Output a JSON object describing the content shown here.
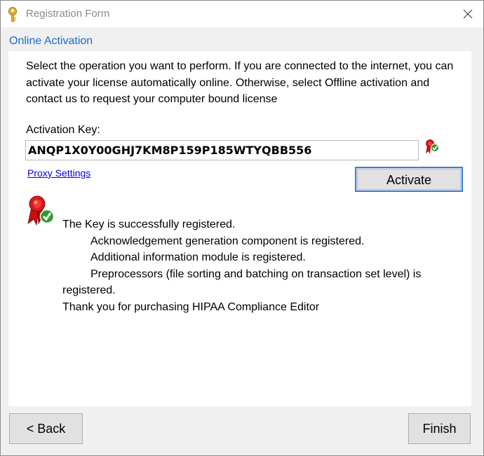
{
  "window": {
    "title": "Registration Form",
    "title_icon": "key-icon",
    "close_icon": "close-icon"
  },
  "section": {
    "header": "Online Activation"
  },
  "description": "Select the operation you want to perform. If you are connected to the internet, you can activate your license automatically online. Otherwise, select Offline activation and contact us to request your computer bound license",
  "activation": {
    "key_label": "Activation Key:",
    "key_value": "ANQP1X0Y00GHJ7KM8P159P185WTYQBB556",
    "proxy_link": "Proxy Settings",
    "activate_label": "Activate",
    "status_icon": "registered-ribbon-icon"
  },
  "result": {
    "line1": "The Key is successfully registered.",
    "line2": "Acknowledgement generation component is registered.",
    "line3": "Additional information module is registered.",
    "line4": "Preprocessors (file sorting and batching on transaction set level) is registered.",
    "line5": "Thank you for purchasing HIPAA Compliance Editor"
  },
  "footer": {
    "back_label": "< Back",
    "finish_label": "Finish"
  },
  "colors": {
    "accent": "#1a6fc8",
    "link": "#0000ee",
    "button_focus_border": "#3c7fd1",
    "ribbon_red": "#cc1111",
    "check_green": "#2e9b2e"
  }
}
